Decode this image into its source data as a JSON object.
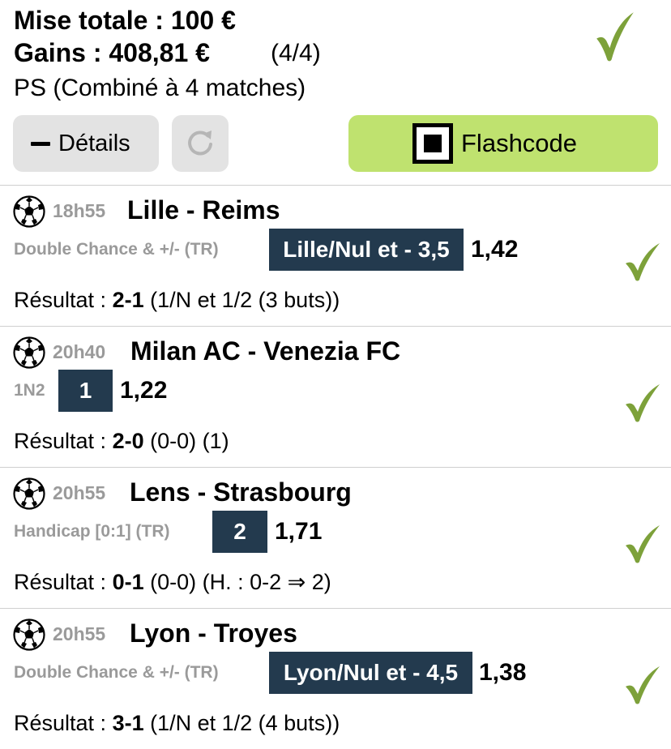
{
  "summary": {
    "stake_label": "Mise totale : 100 €",
    "gains_label": "Gains : 408,81 €",
    "ratio": "(4/4)",
    "bet_type": "PS (Combiné à 4 matches)"
  },
  "actions": {
    "details_label": "Détails",
    "flashcode_label": "Flashcode"
  },
  "colors": {
    "check": "#7da13a",
    "flash_button": "#bfe26f",
    "selection_bg": "#233a4e"
  },
  "matches": [
    {
      "time": "18h55",
      "teams": "Lille - Reims",
      "market": "Double Chance & +/- (TR)",
      "selection": "Lille/Nul et - 3,5",
      "odds": "1,42",
      "result_label": "Résultat : ",
      "score": "2-1",
      "result_detail": " (1/N et 1/2 (3 buts))"
    },
    {
      "time": "20h40",
      "teams": "Milan AC - Venezia FC",
      "market": "1N2",
      "selection": "1",
      "odds": "1,22",
      "result_label": "Résultat : ",
      "score": "2-0",
      "result_detail": " (0-0) (1)"
    },
    {
      "time": "20h55",
      "teams": "Lens - Strasbourg",
      "market": "Handicap [0:1] (TR)",
      "selection": "2",
      "odds": "1,71",
      "result_label": "Résultat : ",
      "score": "0-1",
      "result_detail": " (0-0) (H. : 0-2 ⇒ 2)"
    },
    {
      "time": "20h55",
      "teams": "Lyon - Troyes",
      "market": "Double Chance & +/- (TR)",
      "selection": "Lyon/Nul et - 4,5",
      "odds": "1,38",
      "result_label": "Résultat : ",
      "score": "3-1",
      "result_detail": " (1/N et 1/2 (4 buts))"
    }
  ]
}
